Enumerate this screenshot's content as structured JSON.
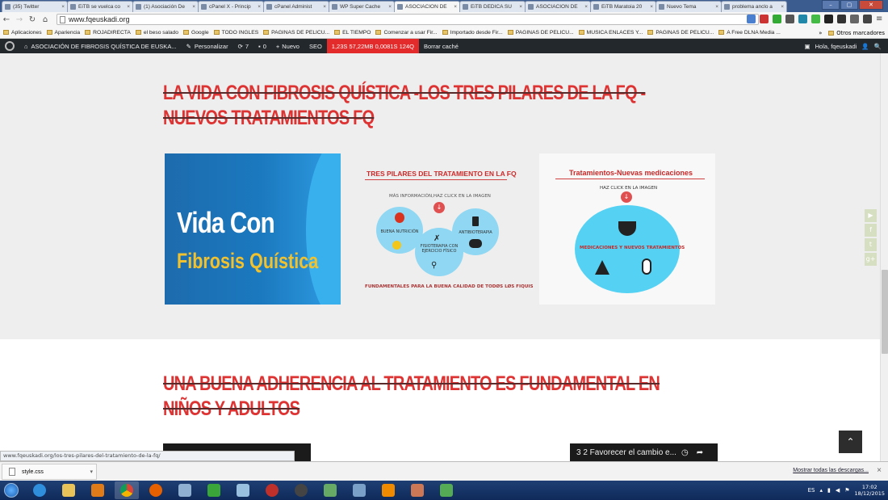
{
  "browser": {
    "tabs": [
      {
        "label": "(35) Twitter",
        "active": false
      },
      {
        "label": "EiTB se vuelca co",
        "active": false
      },
      {
        "label": "(1) Asociación De",
        "active": false
      },
      {
        "label": "cPanel X - Princip",
        "active": false
      },
      {
        "label": "cPanel Administ",
        "active": false
      },
      {
        "label": "WP Super Cache",
        "active": false
      },
      {
        "label": "ASOCIACIÓN DE",
        "active": true
      },
      {
        "label": "EiTB DEDICA SU",
        "active": false
      },
      {
        "label": "ASOCIACIÓN DE",
        "active": false
      },
      {
        "label": "EiTB Maratoia 20",
        "active": false
      },
      {
        "label": "Nuevo Tema",
        "active": false
      },
      {
        "label": "problema anclo a",
        "active": false
      }
    ],
    "url": "www.fqeuskadi.org",
    "bookmarks": [
      "Aplicaciones",
      "Apariencia",
      "ROJADIRECTA",
      "el beso salado",
      "Google",
      "TODO INGLES",
      "PAGINAS DE PELICU...",
      "EL TIEMPO",
      "Comenzar a usar Fir...",
      "Importado desde Fir...",
      "PAGINAS DE PELICU...",
      "MUSICA ENLACES Y...",
      "PAGINAS DE PELICU...",
      "A Free DLNA Media ..."
    ],
    "bookmarks_more": "»",
    "bookmarks_other": "Otros marcadores",
    "status_url": "www.fqeuskadi.org/los-tres-pilares-del-tratamiento-de-la-fq/"
  },
  "wp_admin_bar": {
    "site_name": "ASOCIACIÓN DE FIBROSIS QUÍSTICA DE EUSKA...",
    "customize": "Personalizar",
    "updates_count": "7",
    "comments_count": "0",
    "new_label": "Nuevo",
    "seo_label": "SEO",
    "query_monitor": "1,23S  57,22MB  0,0081S  124Q",
    "clear_cache": "Borrar caché",
    "greeting": "Hola, fqeuskadi"
  },
  "page": {
    "heading1": "LA VIDA CON FIBROSIS QUÍSTICA -LOS TRES PILARES DE LA FQ -",
    "heading1b": "NUEVOS TRATAMIENTOS FQ",
    "card1": {
      "line1": "Vida Con",
      "line2": "Fibrosis Quística"
    },
    "card2": {
      "title": "TRES PILARES DEL TRATAMIENTO EN LA FQ",
      "more_info": "MÁS INFORMACIÓN,HAZ CLICK EN LA IMAGEN",
      "pillar1": "BUENA NUTRICIÓN",
      "pillar2": "ANTIBIOTERAPIA",
      "pillar3": "FISIOTERAPIA CON EJERCICIO FÍSICO",
      "footer": "FUNDAMENTALES PARA LA BUENA CALIDAD DE TODØS LØS FIQUIS"
    },
    "card3": {
      "title": "Tratamientos-Nuevas medicaciones",
      "click": "HAZ CLICK EN LA IMAGEN",
      "circle_text": "MEDICACIONES Y NUEVOS TRATAMIENTOS"
    },
    "heading2": "UNA BUENA ADHERENCIA AL TRATAMIENTO ES FUNDAMENTAL EN",
    "heading2b": "NIÑOS Y ADULTOS",
    "video2_title": "3 2 Favorecer el cambio e..."
  },
  "downloads": {
    "file": "style.css",
    "show_all": "Mostrar todas las descargas..."
  },
  "taskbar": {
    "lang": "ES",
    "time": "17:02",
    "date": "18/12/2015"
  },
  "colors": {
    "heading_red": "#dd3333",
    "wp_bar": "#23282d",
    "query_monitor": "#e32b2b"
  }
}
